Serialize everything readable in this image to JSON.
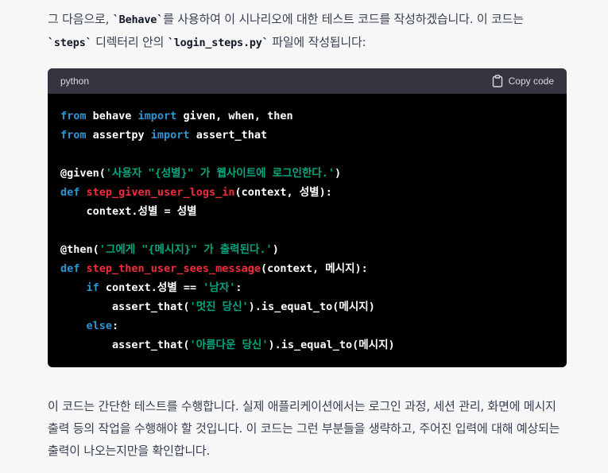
{
  "intro": {
    "p1": "그 다음으로, ",
    "code1": "`Behave`",
    "p2": "를 사용하여 이 시나리오에 대한 테스트 코드를 작성하겠습니다. 이 코드는",
    "code2": "`steps`",
    "p3": " 디렉터리 안의 ",
    "code3": "`login_steps.py`",
    "p4": " 파일에 작성됩니다:"
  },
  "code_block": {
    "language": "python",
    "copy_label": "Copy code",
    "copy_icon": "clipboard-icon",
    "lines": [
      [
        [
          "kw",
          "from"
        ],
        [
          "t",
          " behave "
        ],
        [
          "kw",
          "import"
        ],
        [
          "t",
          " given, when, then"
        ]
      ],
      [
        [
          "kw",
          "from"
        ],
        [
          "t",
          " assertpy "
        ],
        [
          "kw",
          "import"
        ],
        [
          "t",
          " assert_that"
        ]
      ],
      [],
      [
        [
          "dec",
          "@given"
        ],
        [
          "t",
          "("
        ],
        [
          "str",
          "'사용자 \"{성별}\" 가 웹사이트에 로그인한다.'"
        ],
        [
          "t",
          ")"
        ]
      ],
      [
        [
          "kw",
          "def"
        ],
        [
          "t",
          " "
        ],
        [
          "fn",
          "step_given_user_logs_in"
        ],
        [
          "t",
          "(context, 성별):"
        ]
      ],
      [
        [
          "t",
          "    context.성별 = 성별"
        ]
      ],
      [],
      [
        [
          "dec",
          "@then"
        ],
        [
          "t",
          "("
        ],
        [
          "str",
          "'그에게 \"{메시지}\" 가 출력된다.'"
        ],
        [
          "t",
          ")"
        ]
      ],
      [
        [
          "kw",
          "def"
        ],
        [
          "t",
          " "
        ],
        [
          "fn",
          "step_then_user_sees_message"
        ],
        [
          "t",
          "(context, 메시지):"
        ]
      ],
      [
        [
          "t",
          "    "
        ],
        [
          "kw",
          "if"
        ],
        [
          "t",
          " context.성별 == "
        ],
        [
          "str",
          "'남자'"
        ],
        [
          "t",
          ":"
        ]
      ],
      [
        [
          "t",
          "        assert_that("
        ],
        [
          "str",
          "'멋진 당신'"
        ],
        [
          "t",
          ").is_equal_to(메시지)"
        ]
      ],
      [
        [
          "t",
          "    "
        ],
        [
          "kw",
          "else"
        ],
        [
          "t",
          ":"
        ]
      ],
      [
        [
          "t",
          "        assert_that("
        ],
        [
          "str",
          "'아름다운 당신'"
        ],
        [
          "t",
          ").is_equal_to(메시지)"
        ]
      ]
    ]
  },
  "outro": {
    "text": "이 코드는 간단한 테스트를 수행합니다. 실제 애플리케이션에서는 로그인 과정, 세션 관리, 화면에 메시지 출력 등의 작업을 수행해야 할 것입니다. 이 코드는 그런 부분들을 생략하고, 주어진 입력에 대해 예상되는 출력이 나오는지만을 확인합니다."
  },
  "colors": {
    "background": "#f7f7f8",
    "code_bg": "#000000",
    "code_header_bg": "#343541",
    "keyword": "#2e95d3",
    "function_name": "#f22c3d",
    "string": "#00a67d"
  }
}
